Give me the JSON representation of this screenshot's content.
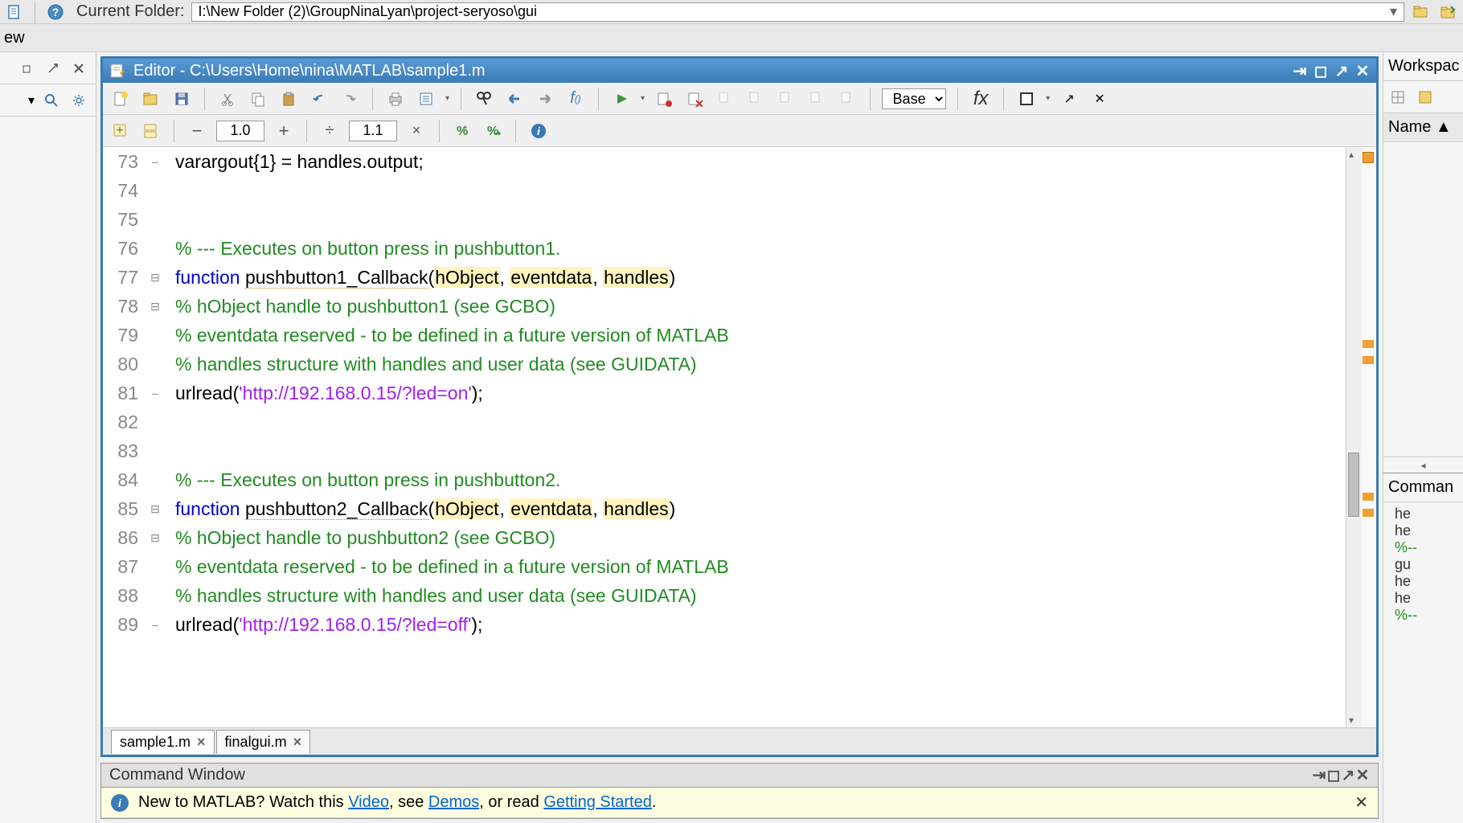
{
  "toolbar": {
    "folder_label": "Current Folder:",
    "folder_path": "I:\\New Folder (2)\\GroupNinaLyan\\project-seryoso\\gui"
  },
  "left": {
    "view_label": "ew"
  },
  "editor": {
    "title_prefix": "Editor - ",
    "title_path": "C:\\Users\\Home\\nina\\MATLAB\\sample1.m",
    "zoom1": "1.0",
    "zoom2": "1.1",
    "stack": "Base"
  },
  "tabs": [
    {
      "name": "sample1.m",
      "active": true
    },
    {
      "name": "finalgui.m",
      "active": false
    }
  ],
  "code": [
    {
      "n": 73,
      "fold": "–",
      "segs": [
        {
          "t": "varargout{1} = handles.output;",
          "c": ""
        }
      ]
    },
    {
      "n": 74,
      "fold": "",
      "segs": []
    },
    {
      "n": 75,
      "fold": "",
      "segs": []
    },
    {
      "n": 76,
      "fold": "",
      "segs": [
        {
          "t": "% --- Executes on button press in pushbutton1.",
          "c": "cm"
        }
      ]
    },
    {
      "n": 77,
      "fold": "⊟",
      "segs": [
        {
          "t": "function",
          "c": "kw"
        },
        {
          "t": " ",
          "c": ""
        },
        {
          "t": "pushbutton1_Callback",
          "c": "fn"
        },
        {
          "t": "(",
          "c": ""
        },
        {
          "t": "hObject",
          "c": "hl"
        },
        {
          "t": ", ",
          "c": ""
        },
        {
          "t": "eventdata",
          "c": "hl"
        },
        {
          "t": ", ",
          "c": ""
        },
        {
          "t": "handles",
          "c": "hl"
        },
        {
          "t": ")",
          "c": ""
        }
      ]
    },
    {
      "n": 78,
      "fold": "⊟",
      "segs": [
        {
          "t": "% hObject    handle to pushbutton1 (see GCBO)",
          "c": "cm"
        }
      ]
    },
    {
      "n": 79,
      "fold": "",
      "segs": [
        {
          "t": "% eventdata  reserved - to be defined in a future version of MATLAB",
          "c": "cm"
        }
      ]
    },
    {
      "n": 80,
      "fold": "",
      "segs": [
        {
          "t": "% handles    structure with handles and user data (see GUIDATA)",
          "c": "cm"
        }
      ]
    },
    {
      "n": 81,
      "fold": "–",
      "segs": [
        {
          "t": "urlread(",
          "c": ""
        },
        {
          "t": "'http://192.168.0.15/?led=on'",
          "c": "str"
        },
        {
          "t": ");",
          "c": ""
        }
      ]
    },
    {
      "n": 82,
      "fold": "",
      "segs": []
    },
    {
      "n": 83,
      "fold": "",
      "segs": []
    },
    {
      "n": 84,
      "fold": "",
      "segs": [
        {
          "t": "% --- Executes on button press in pushbutton2.",
          "c": "cm"
        }
      ]
    },
    {
      "n": 85,
      "fold": "⊟",
      "segs": [
        {
          "t": "function",
          "c": "kw"
        },
        {
          "t": " ",
          "c": ""
        },
        {
          "t": "pushbutton2_Callback",
          "c": "fn"
        },
        {
          "t": "(",
          "c": ""
        },
        {
          "t": "hObject",
          "c": "hl"
        },
        {
          "t": ", ",
          "c": ""
        },
        {
          "t": "eventdata",
          "c": "hl"
        },
        {
          "t": ", ",
          "c": ""
        },
        {
          "t": "handles",
          "c": "hl"
        },
        {
          "t": ")",
          "c": ""
        }
      ]
    },
    {
      "n": 86,
      "fold": "⊟",
      "segs": [
        {
          "t": "% hObject    handle to pushbutton2 (see GCBO)",
          "c": "cm"
        }
      ]
    },
    {
      "n": 87,
      "fold": "",
      "segs": [
        {
          "t": "% eventdata  reserved - to be defined in a future version of MATLAB",
          "c": "cm"
        }
      ]
    },
    {
      "n": 88,
      "fold": "",
      "segs": [
        {
          "t": "% handles    structure with handles and user data (see GUIDATA)",
          "c": "cm"
        }
      ]
    },
    {
      "n": 89,
      "fold": "–",
      "segs": [
        {
          "t": "urlread(",
          "c": ""
        },
        {
          "t": "'http://192.168.0.15/?led=off'",
          "c": "str"
        },
        {
          "t": ");",
          "c": ""
        }
      ]
    }
  ],
  "command": {
    "title": "Command Window",
    "banner_pre": "New to MATLAB? Watch this ",
    "link1": "Video",
    "banner_mid1": ", see ",
    "link2": "Demos",
    "banner_mid2": ", or read ",
    "link3": "Getting Started",
    "banner_post": "."
  },
  "workspace": {
    "title": "Workspac",
    "col_name": "Name",
    "cmd_hist_title": "Comman",
    "items": [
      "he",
      "he",
      "%--",
      "gu",
      "he",
      "he",
      "%--"
    ]
  }
}
